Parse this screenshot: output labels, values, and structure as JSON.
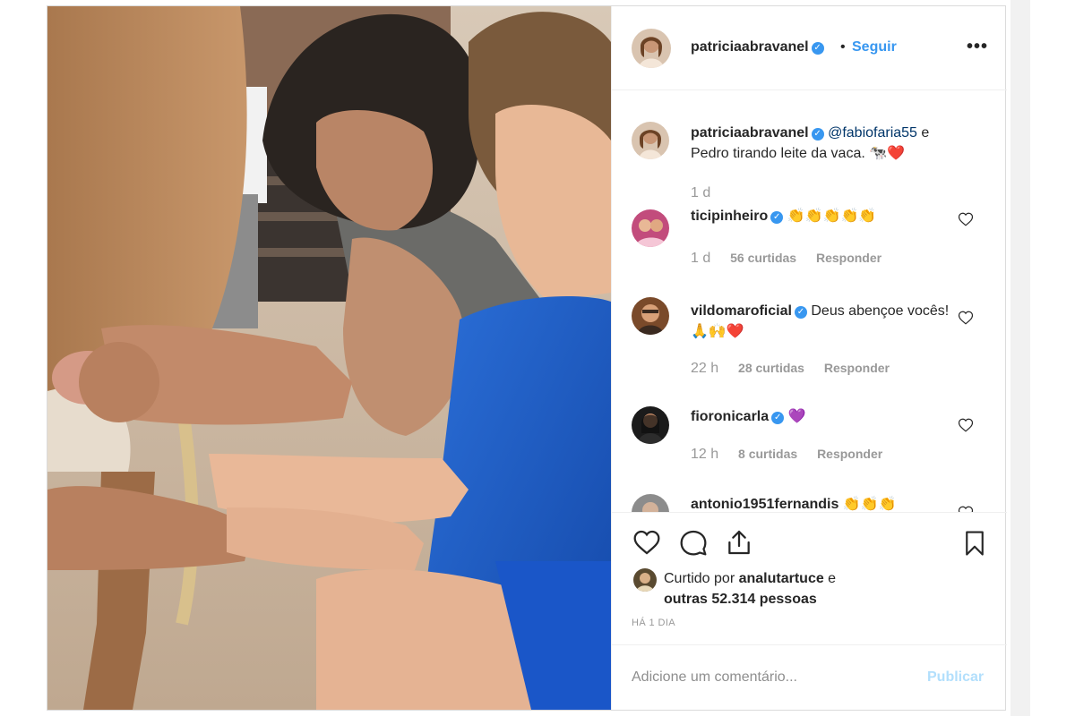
{
  "post": {
    "author": "patriciaabravanel",
    "follow_label": "Seguir",
    "dot": "•",
    "more_label": "•••"
  },
  "caption": {
    "user": "patriciaabravanel",
    "mention": "@fabiofaria55",
    "text_after_mention": " e Pedro tirando leite da vaca. ",
    "emoji": "🐄❤️",
    "time": "1 d"
  },
  "comments": [
    {
      "user": "ticipinheiro",
      "text": "👏👏👏👏👏",
      "time": "1 d",
      "likes": "56 curtidas",
      "reply": "Responder"
    },
    {
      "user": "vildomaroficial",
      "text": "Deus abençoe vocês! 🙏🙌❤️",
      "time": "22 h",
      "likes": "28 curtidas",
      "reply": "Responder"
    },
    {
      "user": "fioronicarla",
      "text": "💜",
      "time": "12 h",
      "likes": "8 curtidas",
      "reply": "Responder"
    },
    {
      "user": "antonio1951fernandis",
      "text": "👏👏👏"
    }
  ],
  "likes": {
    "prefix": "Curtido por ",
    "user": "analutartuce",
    "middle": " e",
    "others": "outras 52.314 pessoas"
  },
  "posted_ago": "HÁ 1 DIA",
  "comment_box": {
    "placeholder": "Adicione um comentário...",
    "publish_label": "Publicar"
  },
  "colors": {
    "accent": "#3897f0",
    "publish_disabled": "#b2dffc",
    "muted": "#999999",
    "heart_red": "#ed4956"
  },
  "icons": {
    "verified": "verified-badge-icon",
    "like": "heart-outline-icon",
    "comment": "comment-bubble-icon",
    "share": "share-upload-icon",
    "save": "bookmark-icon"
  }
}
